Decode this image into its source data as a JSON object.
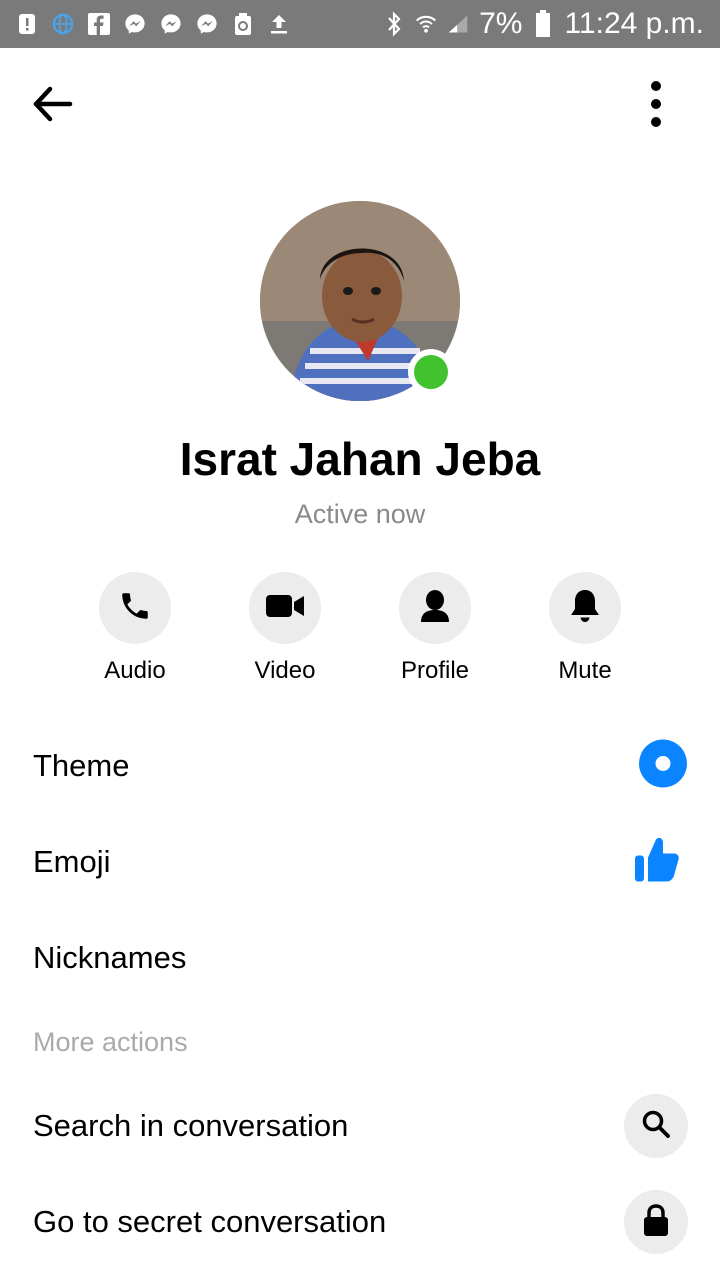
{
  "status_bar": {
    "battery": "7%",
    "time": "11:24 p.m.",
    "icons": [
      "alert-icon",
      "browser-icon",
      "facebook-icon",
      "messenger-icon",
      "messenger-icon",
      "messenger-icon",
      "recycle-icon",
      "upload-icon",
      "bluetooth-icon",
      "wifi-icon",
      "signal-icon",
      "battery-icon"
    ]
  },
  "header": {
    "back_icon": "back-arrow-icon",
    "menu_icon": "more-vert-icon"
  },
  "profile": {
    "name": "Israt Jahan Jeba",
    "status": "Active now",
    "online_color": "#42c22f"
  },
  "actions": [
    {
      "label": "Audio",
      "icon": "phone-icon"
    },
    {
      "label": "Video",
      "icon": "video-camera-icon"
    },
    {
      "label": "Profile",
      "icon": "person-icon"
    },
    {
      "label": "Mute",
      "icon": "bell-icon"
    }
  ],
  "settings": {
    "theme_label": "Theme",
    "emoji_label": "Emoji",
    "nicknames_label": "Nicknames",
    "accent_color": "#0a84ff"
  },
  "more_actions": {
    "section_label": "More actions",
    "search_label": "Search in conversation",
    "secret_label": "Go to secret conversation"
  }
}
